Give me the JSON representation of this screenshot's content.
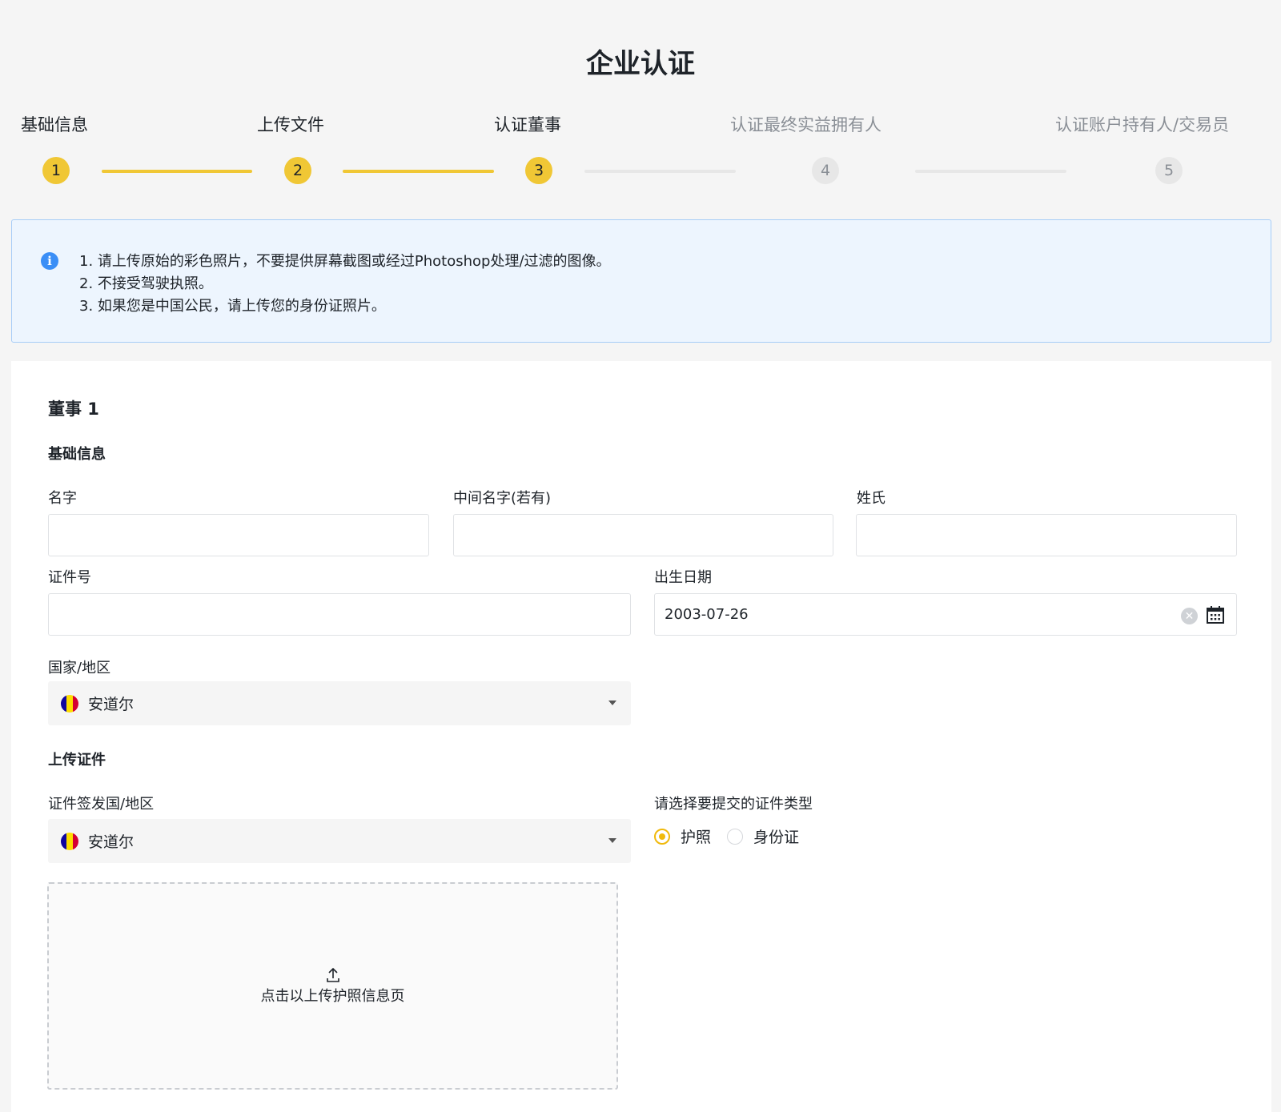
{
  "page": {
    "title": "企业认证"
  },
  "steps": [
    {
      "label": "基础信息",
      "number": "1",
      "state": "done"
    },
    {
      "label": "上传文件",
      "number": "2",
      "state": "done"
    },
    {
      "label": "认证董事",
      "number": "3",
      "state": "current"
    },
    {
      "label": "认证最终实益拥有人",
      "number": "4",
      "state": "todo"
    },
    {
      "label": "认证账户持有人/交易员",
      "number": "5",
      "state": "todo"
    }
  ],
  "notice": {
    "lines": [
      "1. 请上传原始的彩色照片，不要提供屏幕截图或经过Photoshop处理/过滤的图像。",
      "2. 不接受驾驶执照。",
      "3. 如果您是中国公民，请上传您的身份证照片。"
    ]
  },
  "form": {
    "director_title": "董事 1",
    "basic_section": "基础信息",
    "first_name_label": "名字",
    "first_name_value": "",
    "middle_name_label": "中间名字(若有)",
    "middle_name_value": "",
    "last_name_label": "姓氏",
    "last_name_value": "",
    "id_number_label": "证件号",
    "id_number_value": "",
    "dob_label": "出生日期",
    "dob_value": "2003-07-26",
    "country_label": "国家/地区",
    "country_value": "安道尔",
    "upload_section": "上传证件",
    "issuing_country_label": "证件签发国/地区",
    "issuing_country_value": "安道尔",
    "doc_type_label": "请选择要提交的证件类型",
    "doc_type_options": [
      {
        "label": "护照",
        "selected": true
      },
      {
        "label": "身份证",
        "selected": false
      }
    ],
    "upload_prompt": "点击以上传护照信息页"
  },
  "colors": {
    "accent": "#f0c735",
    "info_blue": "#3a8ef6",
    "notice_bg": "#edf5fe",
    "flag_andorra": [
      "#10069f",
      "#fedd00",
      "#d50032"
    ]
  },
  "icons": [
    "info-icon",
    "clear-icon",
    "calendar-icon",
    "chevron-down-icon",
    "upload-icon",
    "andorra-flag-icon"
  ]
}
